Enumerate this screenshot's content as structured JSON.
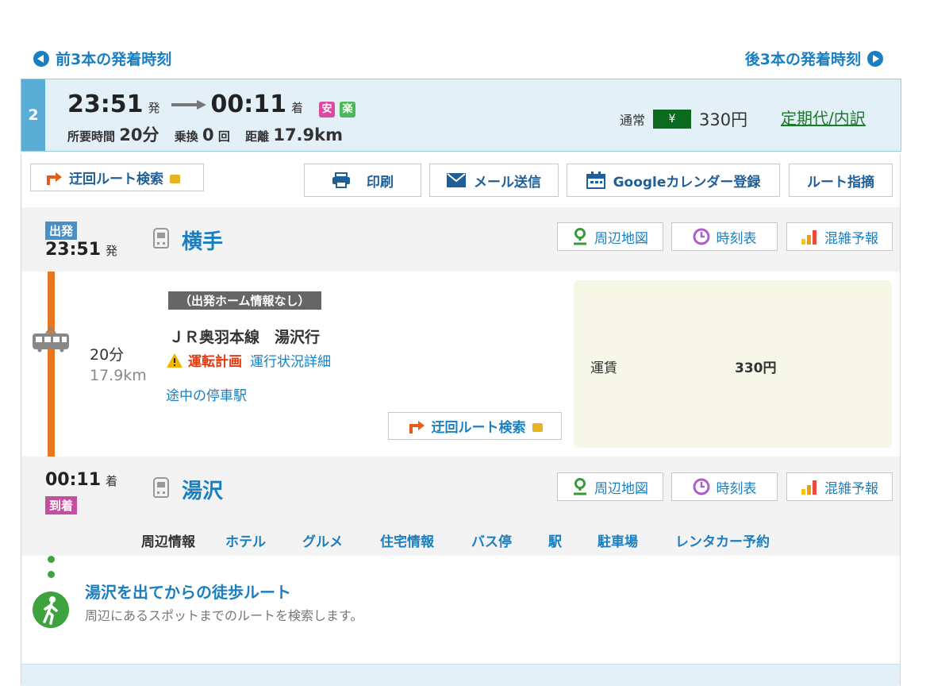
{
  "nav": {
    "prev_label": "前3本の発着時刻",
    "next_label": "後3本の発着時刻"
  },
  "summary": {
    "route_no": "2",
    "dep_time": "23:51",
    "dep_suffix": "発",
    "arr_time": "00:11",
    "arr_suffix": "着",
    "badge_safe": "安",
    "badge_easy": "楽",
    "duration_label": "所要時間",
    "duration_value": "20分",
    "transfer_label": "乗換",
    "transfer_value": "0",
    "transfer_unit": "回",
    "distance_label": "距離",
    "distance_value": "17.9km",
    "fare_type": "通常",
    "yen_symbol": "¥",
    "fare": "330円",
    "teiki_link": "定期代/内訳"
  },
  "toolbar": {
    "detour": "迂回ルート検索",
    "print": "印刷",
    "mail": "メール送信",
    "calendar": "Googleカレンダー登録",
    "report": "ルート指摘"
  },
  "origin": {
    "tag": "出発",
    "time": "23:51",
    "suffix": "発",
    "name": "横手",
    "map": "周辺地図",
    "timetable": "時刻表",
    "crowd": "混雑予報"
  },
  "segment": {
    "platform_note": "（出発ホーム情報なし）",
    "line": "ＪＲ奥羽本線　湯沢行",
    "duration": "20分",
    "distance": "17.9km",
    "status_warn": "運転計画",
    "status_link": "運行状況詳細",
    "stops_link": "途中の停車駅",
    "detour": "迂回ルート検索",
    "fare_label": "運賃",
    "fare_value": "330円"
  },
  "dest": {
    "tag": "到着",
    "time": "00:11",
    "suffix": "着",
    "name": "湯沢",
    "map": "周辺地図",
    "timetable": "時刻表",
    "crowd": "混雑予報"
  },
  "area_links": [
    "周辺情報",
    "ホテル",
    "グルメ",
    "住宅情報",
    "バス停",
    "駅",
    "駐車場",
    "レンタカー予約"
  ],
  "walk": {
    "title": "湯沢を出てからの徒歩ルート",
    "desc": "周辺にあるスポットまでのルートを検索します。"
  },
  "colors": {
    "accent": "#1a7fc1",
    "line": "#e87722",
    "fare_bg": "#f6f7e7",
    "yen_bg": "#0a6b1f",
    "depart_tag": "#4a90c8",
    "arrive_tag": "#c34f9e"
  }
}
